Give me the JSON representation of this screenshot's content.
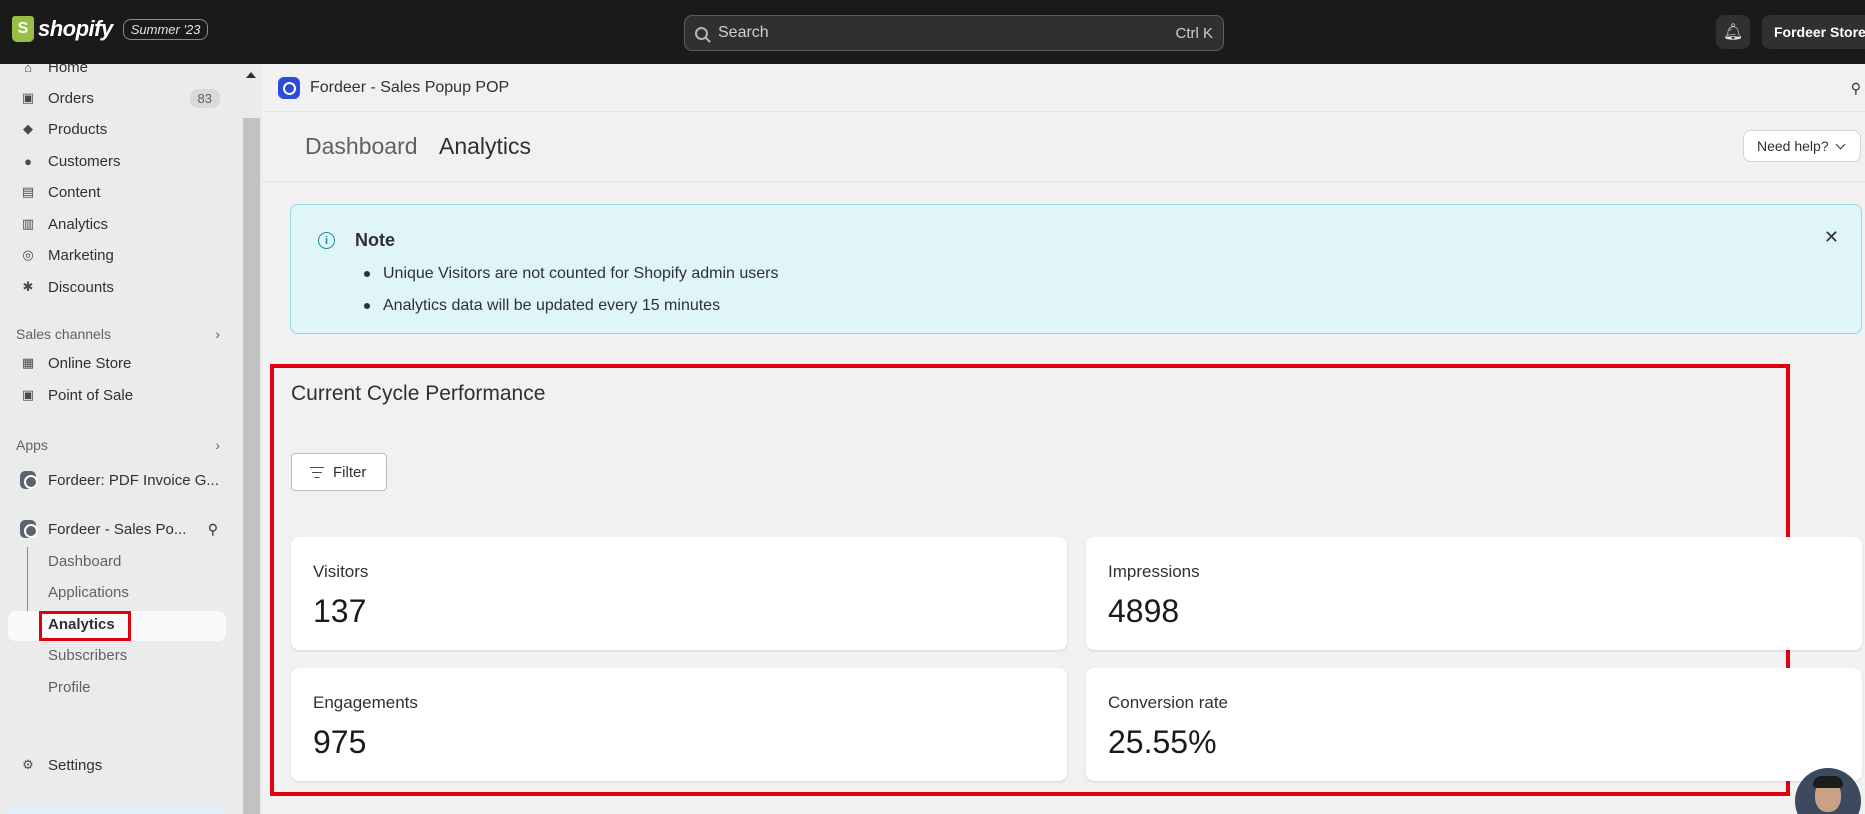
{
  "topbar": {
    "brand": "shopify",
    "brand_badge": "Summer '23",
    "search_placeholder": "Search",
    "search_shortcut": "Ctrl K",
    "store_name": "Fordeer Store"
  },
  "sidebar": {
    "items": [
      {
        "label": "Home",
        "icon": "home-icon"
      },
      {
        "label": "Orders",
        "icon": "inbox-icon",
        "badge": "83"
      },
      {
        "label": "Products",
        "icon": "tag-icon"
      },
      {
        "label": "Customers",
        "icon": "person-icon"
      },
      {
        "label": "Content",
        "icon": "image-icon"
      },
      {
        "label": "Analytics",
        "icon": "bar-chart-icon"
      },
      {
        "label": "Marketing",
        "icon": "target-icon"
      },
      {
        "label": "Discounts",
        "icon": "discount-icon"
      }
    ],
    "sales_channels_label": "Sales channels",
    "sales_channels": [
      {
        "label": "Online Store",
        "icon": "store-icon"
      },
      {
        "label": "Point of Sale",
        "icon": "pos-icon"
      }
    ],
    "apps_label": "Apps",
    "apps": [
      {
        "label": "Fordeer: PDF Invoice G..."
      },
      {
        "label": "Fordeer - Sales Po..."
      }
    ],
    "app_subitems": [
      "Dashboard",
      "Applications",
      "Analytics",
      "Subscribers",
      "Profile"
    ],
    "settings_label": "Settings"
  },
  "app_bar": {
    "title": "Fordeer - Sales Popup POP"
  },
  "page_header": {
    "crumb_parent": "Dashboard",
    "crumb_current": "Analytics",
    "help_label": "Need help?"
  },
  "note": {
    "title": "Note",
    "items": [
      "Unique Visitors are not counted for Shopify admin users",
      "Analytics data will be updated every 15 minutes"
    ]
  },
  "performance": {
    "title": "Current Cycle Performance",
    "filter_label": "Filter",
    "cards": [
      {
        "label": "Visitors",
        "value": "137"
      },
      {
        "label": "Impressions",
        "value": "4898"
      },
      {
        "label": "Engagements",
        "value": "975"
      },
      {
        "label": "Conversion rate",
        "value": "25.55%"
      }
    ]
  }
}
